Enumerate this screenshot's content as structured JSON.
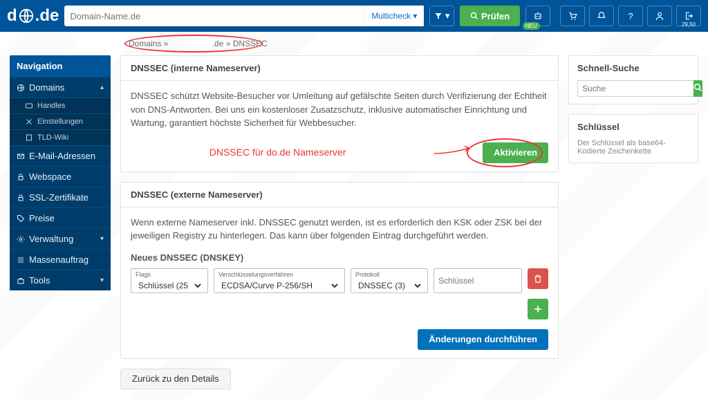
{
  "topbar": {
    "logo_text_a": "d",
    "logo_text_b": ".de",
    "search_placeholder": "Domain-Name.de",
    "multicheck_label": "Multicheck",
    "pruefen_label": "Prüfen",
    "neu_badge": "NEU",
    "credit": "29,50"
  },
  "breadcrumb": {
    "a": "Domains »",
    "b": ".de »",
    "c": "DNSSEC"
  },
  "nav": {
    "title": "Navigation",
    "domains": "Domains",
    "handles": "Handles",
    "einst": "Einstellungen",
    "tldwiki": "TLD-Wiki",
    "email": "E-Mail-Adressen",
    "webspace": "Webspace",
    "ssl": "SSL-Zertifikate",
    "preise": "Preise",
    "verwaltung": "Verwaltung",
    "mass": "Massenauftrag",
    "tools": "Tools"
  },
  "panel1": {
    "title": "DNSSEC (interne Nameserver)",
    "body": "DNSSEC schützt Website-Besucher vor Umleitung auf gefälschte Seiten durch Verifizierung der Echtheit von DNS-Antworten. Bei uns ein kostenloser Zusatzschutz, inklusive automatischer Einrichtung und Wartung, garantiert höchste Sicherheit für Webbesucher.",
    "annotation": "DNSSEC für do.de Nameserver",
    "activate": "Aktivieren"
  },
  "panel2": {
    "title": "DNSSEC (externe Nameserver)",
    "body": "Wenn externe Nameserver inkl. DNSSEC genutzt werden, ist es erforderlich den KSK oder ZSK bei der jeweiligen Registry zu hinterlegen. Das kann über folgenden Eintrag durchgeführt werden.",
    "subhead": "Neues DNSSEC (DNSKEY)",
    "flags_label": "Flags",
    "flags_value": "Schlüssel (25",
    "alg_label": "Verschlüsselungsverfahren",
    "alg_value": "ECDSA/Curve P-256/SH",
    "proto_label": "Protokoll",
    "proto_value": "DNSSEC (3)",
    "key_placeholder": "Schlüssel",
    "submit": "Änderungen durchführen"
  },
  "back_btn": "Zurück zu den Details",
  "side1": {
    "title": "Schnell-Suche",
    "placeholder": "Suche"
  },
  "side2": {
    "title": "Schlüssel",
    "text": "Der Schlüssel als base64-Kodierte Zeichenkette"
  }
}
